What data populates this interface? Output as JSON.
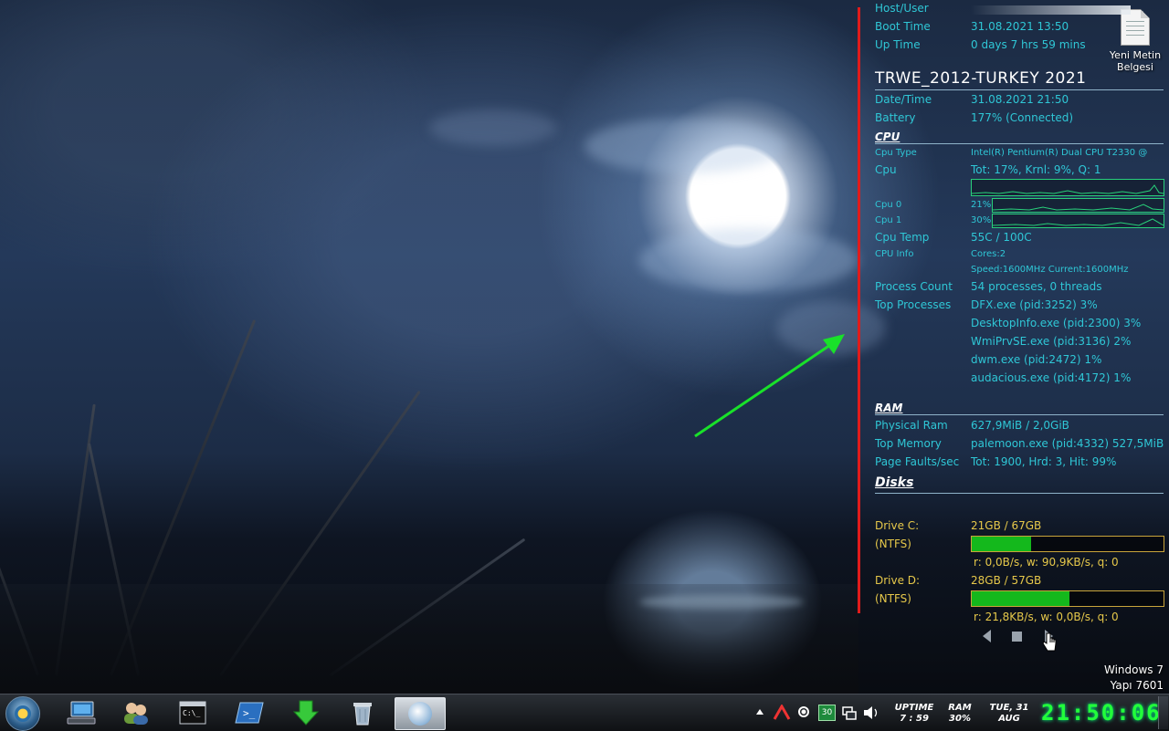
{
  "desktop": {
    "icon_label_line1": "Yeni Metin",
    "icon_label_line2": "Belgesi",
    "watermark_line1": "Windows 7",
    "watermark_line2": "Yapı 7601"
  },
  "conky": {
    "host_label": "Host/User",
    "boot_label": "Boot Time",
    "boot_value": "31.08.2021 13:50",
    "uptime_label": "Up Time",
    "uptime_value": "0 days 7 hrs 59 mins",
    "title": "TRWE_2012-TURKEY 2021",
    "datetime_label": "Date/Time",
    "datetime_value": "31.08.2021 21:50",
    "battery_label": "Battery",
    "battery_value": "177% (Connected)",
    "cpu_section": "CPU",
    "cpu_type_label": "Cpu Type",
    "cpu_type_value": "Intel(R) Pentium(R) Dual CPU T2330 @",
    "cpu_label": "Cpu",
    "cpu_value": "Tot: 17%, Krnl: 9%, Q: 1",
    "cpu0_label": "Cpu 0",
    "cpu0_value": "21%",
    "cpu1_label": "Cpu 1",
    "cpu1_value": "30%",
    "cpu_temp_label": "Cpu Temp",
    "cpu_temp_value": "55C / 100C",
    "cpu_info_label": "CPU Info",
    "cpu_info_cores": "Cores:2",
    "cpu_info_speed": "Speed:1600MHz Current:1600MHz",
    "process_count_label": "Process Count",
    "process_count_value": "54 processes, 0 threads",
    "top_processes_label": "Top Processes",
    "top_processes": [
      "DFX.exe (pid:3252) 3%",
      "DesktopInfo.exe (pid:2300) 3%",
      "WmiPrvSE.exe (pid:3136) 2%",
      "dwm.exe (pid:2472) 1%",
      "audacious.exe (pid:4172) 1%"
    ],
    "ram_section": "RAM",
    "physical_ram_label": "Physical Ram",
    "physical_ram_value": "627,9MiB / 2,0GiB",
    "top_memory_label": "Top Memory",
    "top_memory_value": "palemoon.exe (pid:4332) 527,5MiB",
    "page_faults_label": "Page Faults/sec",
    "page_faults_value": "Tot: 1900, Hrd: 3, Hit: 99%",
    "disks_section": "Disks",
    "drive_c_label": "Drive C:",
    "drive_c_fs": "(NTFS)",
    "drive_c_value": "21GB / 67GB",
    "drive_c_fill": 0.31,
    "drive_c_io": "r: 0,0B/s, w: 90,9KB/s, q: 0",
    "drive_d_label": "Drive D:",
    "drive_d_fs": "(NTFS)",
    "drive_d_value": "28GB / 57GB",
    "drive_d_fill": 0.51,
    "drive_d_io": "r: 21,8KB/s, w: 0,0B/s, q: 0"
  },
  "taskbar": {
    "tray_badge": "30",
    "uptime_label": "UPTIME",
    "uptime_value": "7 : 59",
    "ram_label": "RAM",
    "ram_value": "30%",
    "date_line1": "TUE, 31",
    "date_line2": "AUG",
    "clock": "21:50:06"
  },
  "colors": {
    "accent_cyan": "#2fc7d6",
    "disk_label_yellow": "#e6c84a",
    "bar_fill_green": "#14b81c",
    "clock_green": "#22ff3a",
    "annotation_red": "#e01b1b",
    "annotation_arrow_green": "#19e12a"
  }
}
